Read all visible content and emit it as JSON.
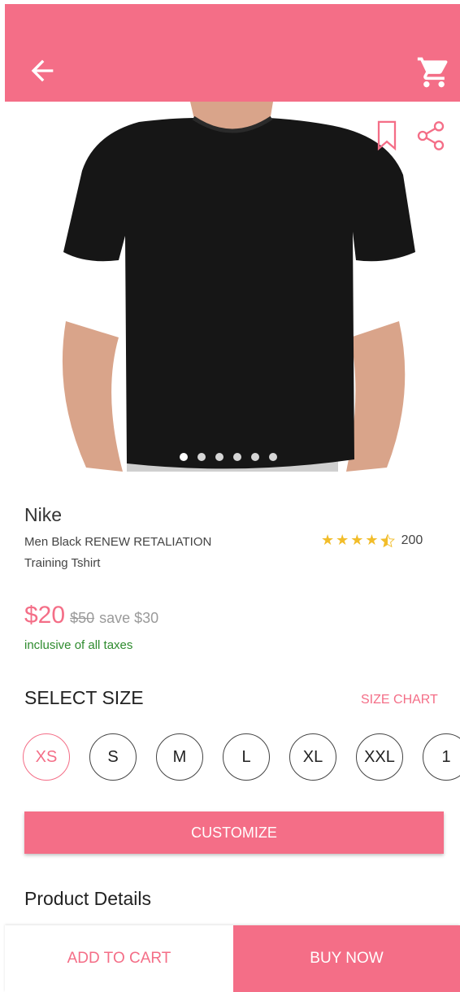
{
  "appbar": {
    "back_icon": "arrow-left-icon",
    "cart_icon": "shopping-cart-icon",
    "color": "#f46e87"
  },
  "product": {
    "brand": "Nike",
    "name": "Men Black RENEW RETALIATION Training Tshirt",
    "rating": 4.5,
    "reviews": "200",
    "price": "$20",
    "old_price": "$50",
    "save": "save $30",
    "tax_note": "inclusive of all taxes",
    "image_count": 6,
    "active_image": 1
  },
  "size_section": {
    "title": "SELECT SIZE",
    "chart_link": "SIZE CHART",
    "sizes": [
      "XS",
      "S",
      "M",
      "L",
      "XL",
      "XXL",
      "1"
    ],
    "selected": "XS"
  },
  "customize_label": "CUSTOMIZE",
  "details_title": "Product Details",
  "bottom": {
    "add_to_cart": "ADD TO CART",
    "buy_now": "BUY NOW"
  }
}
